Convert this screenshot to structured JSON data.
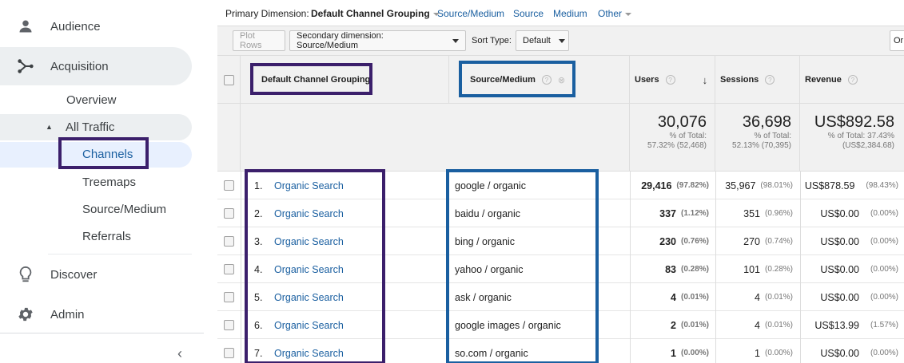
{
  "sidebar": {
    "audience": "Audience",
    "acquisition": "Acquisition",
    "overview": "Overview",
    "all_traffic": "All Traffic",
    "channels": "Channels",
    "treemaps": "Treemaps",
    "source_medium": "Source/Medium",
    "referrals": "Referrals",
    "discover": "Discover",
    "admin": "Admin",
    "collapse": "‹"
  },
  "topbar": {
    "primary_dimension_label": "Primary Dimension:",
    "primary_dimension_value": "Default Channel Grouping",
    "links": [
      "Source/Medium",
      "Source",
      "Medium",
      "Other"
    ]
  },
  "toolbar": {
    "plot_rows": "Plot Rows",
    "secondary_dimension": "Secondary dimension: Source/Medium",
    "sort_type_label": "Sort Type:",
    "sort_type_value": "Default",
    "right_cut": "Or"
  },
  "table": {
    "headers": {
      "dimension": "Default Channel Grouping",
      "secondary": "Source/Medium",
      "users": "Users",
      "sessions": "Sessions",
      "revenue": "Revenue"
    },
    "totals": {
      "users": "30,076",
      "users_pct": "% of Total:",
      "users_total": "57.32% (52,468)",
      "sessions": "36,698",
      "sessions_pct": "% of Total:",
      "sessions_total": "52.13% (70,395)",
      "revenue": "US$892.58",
      "revenue_pct": "% of Total: 37.43%",
      "revenue_total": "(US$2,384.68)"
    },
    "rows": [
      {
        "idx": "1.",
        "channel": "Organic Search",
        "source": "google / organic",
        "users": "29,416",
        "users_pct": "(97.82%)",
        "sessions": "35,967",
        "sessions_pct": "(98.01%)",
        "revenue": "US$878.59",
        "revenue_pct": "(98.43%)"
      },
      {
        "idx": "2.",
        "channel": "Organic Search",
        "source": "baidu / organic",
        "users": "337",
        "users_pct": "(1.12%)",
        "sessions": "351",
        "sessions_pct": "(0.96%)",
        "revenue": "US$0.00",
        "revenue_pct": "(0.00%)"
      },
      {
        "idx": "3.",
        "channel": "Organic Search",
        "source": "bing / organic",
        "users": "230",
        "users_pct": "(0.76%)",
        "sessions": "270",
        "sessions_pct": "(0.74%)",
        "revenue": "US$0.00",
        "revenue_pct": "(0.00%)"
      },
      {
        "idx": "4.",
        "channel": "Organic Search",
        "source": "yahoo / organic",
        "users": "83",
        "users_pct": "(0.28%)",
        "sessions": "101",
        "sessions_pct": "(0.28%)",
        "revenue": "US$0.00",
        "revenue_pct": "(0.00%)"
      },
      {
        "idx": "5.",
        "channel": "Organic Search",
        "source": "ask / organic",
        "users": "4",
        "users_pct": "(0.01%)",
        "sessions": "4",
        "sessions_pct": "(0.01%)",
        "revenue": "US$0.00",
        "revenue_pct": "(0.00%)"
      },
      {
        "idx": "6.",
        "channel": "Organic Search",
        "source": "google images / organic",
        "users": "2",
        "users_pct": "(0.01%)",
        "sessions": "4",
        "sessions_pct": "(0.01%)",
        "revenue": "US$13.99",
        "revenue_pct": "(1.57%)"
      },
      {
        "idx": "7.",
        "channel": "Organic Search",
        "source": "so.com / organic",
        "users": "1",
        "users_pct": "(0.00%)",
        "sessions": "1",
        "sessions_pct": "(0.00%)",
        "revenue": "US$0.00",
        "revenue_pct": "(0.00%)"
      }
    ]
  },
  "colors": {
    "annotation_purple": "#3b1f6b",
    "annotation_blue": "#1a5fa0",
    "link": "#1a5fa0"
  }
}
